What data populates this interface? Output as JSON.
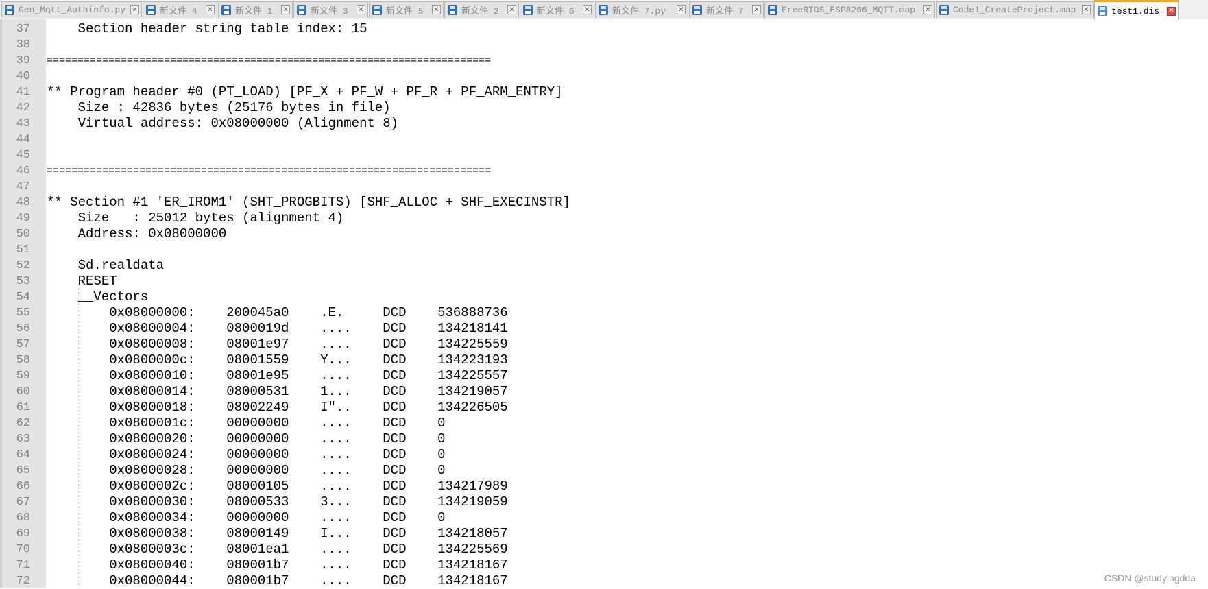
{
  "tabs": [
    {
      "label": "Gen_Mqtt_Authinfo.py",
      "active": false
    },
    {
      "label": "新文件 4",
      "active": false
    },
    {
      "label": "新文件 1",
      "active": false
    },
    {
      "label": "新文件 3",
      "active": false
    },
    {
      "label": "新文件 5",
      "active": false
    },
    {
      "label": "新文件 2",
      "active": false
    },
    {
      "label": "新文件 6",
      "active": false
    },
    {
      "label": "新文件 7.py",
      "active": false
    },
    {
      "label": "新文件 7",
      "active": false
    },
    {
      "label": "FreeRTOS_ESP8266_MQTT.map",
      "active": false
    },
    {
      "label": "Code1_CreateProject.map",
      "active": false
    },
    {
      "label": "test1.dis",
      "active": true
    }
  ],
  "close_glyph": "✕",
  "lines": [
    {
      "n": "37",
      "text": "    Section header string table index: 15"
    },
    {
      "n": "38",
      "text": ""
    },
    {
      "n": "39",
      "text": "========================================================================"
    },
    {
      "n": "40",
      "text": ""
    },
    {
      "n": "41",
      "text": "** Program header #0 (PT_LOAD) [PF_X + PF_W + PF_R + PF_ARM_ENTRY]"
    },
    {
      "n": "42",
      "text": "    Size : 42836 bytes (25176 bytes in file)"
    },
    {
      "n": "43",
      "text": "    Virtual address: 0x08000000 (Alignment 8)"
    },
    {
      "n": "44",
      "text": ""
    },
    {
      "n": "45",
      "text": ""
    },
    {
      "n": "46",
      "text": "========================================================================"
    },
    {
      "n": "47",
      "text": ""
    },
    {
      "n": "48",
      "text": "** Section #1 'ER_IROM1' (SHT_PROGBITS) [SHF_ALLOC + SHF_EXECINSTR]"
    },
    {
      "n": "49",
      "text": "    Size   : 25012 bytes (alignment 4)"
    },
    {
      "n": "50",
      "text": "    Address: 0x08000000"
    },
    {
      "n": "51",
      "text": ""
    },
    {
      "n": "52",
      "text": "    $d.realdata"
    },
    {
      "n": "53",
      "text": "    RESET"
    },
    {
      "n": "54",
      "text": "    __Vectors"
    },
    {
      "n": "55",
      "text": "        0x08000000:    200045a0    .E.     DCD    536888736"
    },
    {
      "n": "56",
      "text": "        0x08000004:    0800019d    ....    DCD    134218141"
    },
    {
      "n": "57",
      "text": "        0x08000008:    08001e97    ....    DCD    134225559"
    },
    {
      "n": "58",
      "text": "        0x0800000c:    08001559    Y...    DCD    134223193"
    },
    {
      "n": "59",
      "text": "        0x08000010:    08001e95    ....    DCD    134225557"
    },
    {
      "n": "60",
      "text": "        0x08000014:    08000531    1...    DCD    134219057"
    },
    {
      "n": "61",
      "text": "        0x08000018:    08002249    I\"..    DCD    134226505"
    },
    {
      "n": "62",
      "text": "        0x0800001c:    00000000    ....    DCD    0"
    },
    {
      "n": "63",
      "text": "        0x08000020:    00000000    ....    DCD    0"
    },
    {
      "n": "64",
      "text": "        0x08000024:    00000000    ....    DCD    0"
    },
    {
      "n": "65",
      "text": "        0x08000028:    00000000    ....    DCD    0"
    },
    {
      "n": "66",
      "text": "        0x0800002c:    08000105    ....    DCD    134217989"
    },
    {
      "n": "67",
      "text": "        0x08000030:    08000533    3...    DCD    134219059"
    },
    {
      "n": "68",
      "text": "        0x08000034:    00000000    ....    DCD    0"
    },
    {
      "n": "69",
      "text": "        0x08000038:    08000149    I...    DCD    134218057"
    },
    {
      "n": "70",
      "text": "        0x0800003c:    08001ea1    ....    DCD    134225569"
    },
    {
      "n": "71",
      "text": "        0x08000040:    080001b7    ....    DCD    134218167"
    },
    {
      "n": "72",
      "text": "        0x08000044:    080001b7    ....    DCD    134218167"
    }
  ],
  "watermark": "CSDN @studyingdda"
}
